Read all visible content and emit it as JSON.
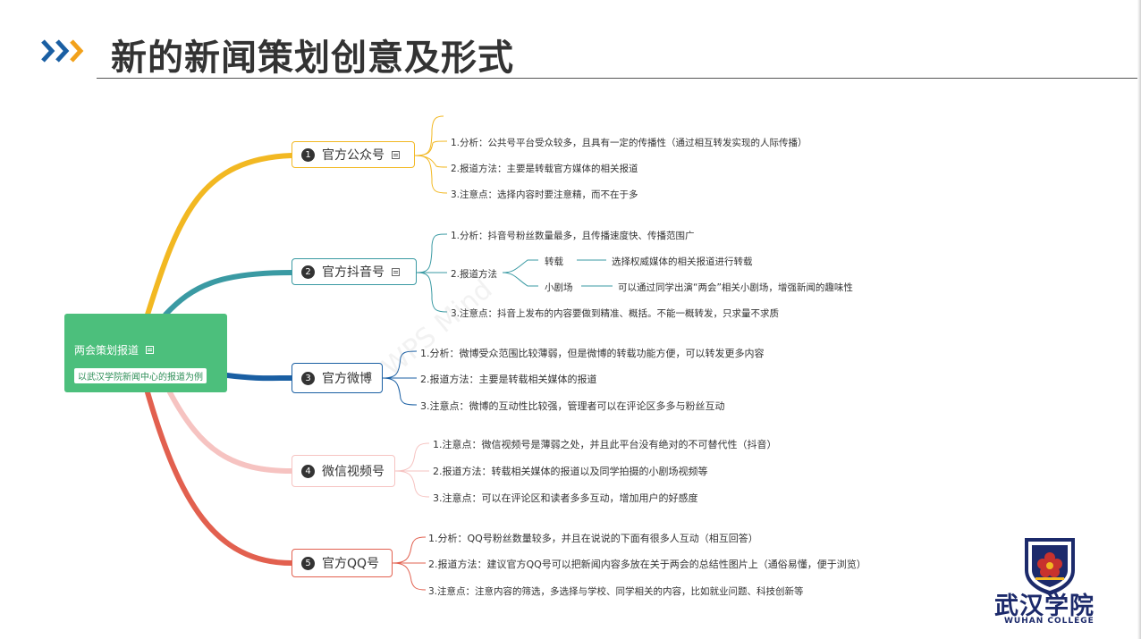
{
  "slide": {
    "title": "新的新闻策划创意及形式",
    "watermark": "WPS Mind"
  },
  "mindmap": {
    "root": {
      "title": "两会策划报道",
      "subtitle": "以武汉学院新闻中心的报道为例",
      "color": "#4cbf7c"
    },
    "topics": [
      {
        "number": "1",
        "label": "官方公众号",
        "color": "#f2b822",
        "items": [
          "1.分析：公共号平台受众较多，且具有一定的传播性（通过相互转发实现的人际传播）",
          "2.报道方法：主要是转载官方媒体的相关报道",
          "3.注意点：选择内容时要注意精，而不在于多"
        ]
      },
      {
        "number": "2",
        "label": "官方抖音号",
        "color": "#3a9aa3",
        "items": [
          "1.分析：抖音号粉丝数量最多，且传播速度快、传播范围广",
          "2.报道方法",
          "3.注意点：抖音上发布的内容要做到精准、概括。不能一概转发，只求量不求质"
        ],
        "sub_items": [
          {
            "label": "转载",
            "detail": "选择权威媒体的相关报道进行转载"
          },
          {
            "label": "小剧场",
            "detail": "可以通过同学出演“两会”相关小剧场，增强新闻的趣味性"
          }
        ]
      },
      {
        "number": "3",
        "label": "官方微博",
        "color": "#1a5fa3",
        "items": [
          "1.分析：微博受众范围比较薄弱，但是微博的转载功能方便，可以转发更多内容",
          "2.报道方法：主要是转载相关媒体的报道",
          "3.注意点：微博的互动性比较强，管理者可以在评论区多多与粉丝互动"
        ]
      },
      {
        "number": "4",
        "label": "微信视频号",
        "color": "#f6c3c1",
        "items": [
          "1.注意点：微信视频号是薄弱之处，并且此平台没有绝对的不可替代性（抖音）",
          "2.报道方法：转载相关媒体的报道以及同学拍摄的小剧场视频等",
          "3.注意点：可以在评论区和读者多多互动，增加用户的好感度"
        ]
      },
      {
        "number": "5",
        "label": "官方QQ号",
        "color": "#e2604f",
        "items": [
          "1.分析：QQ号粉丝数量较多，并且在说说的下面有很多人互动（相互回答）",
          "2.报道方法：建议官方QQ号可以把新闻内容多放在关于两会的总结性图片上（通俗易懂，便于浏览）",
          "3.注意点：注意内容的筛选，多选择与学校、同学相关的内容，比如就业问题、科技创新等"
        ]
      }
    ]
  },
  "logo": {
    "name": "武汉学院",
    "english": "WUHAN COLLEGE"
  },
  "colors": {
    "title_arrow_blue": "#1a5fa3",
    "title_arrow_orange": "#f2a11a",
    "logo_navy": "#1c2a6b",
    "logo_red": "#c8322d"
  }
}
